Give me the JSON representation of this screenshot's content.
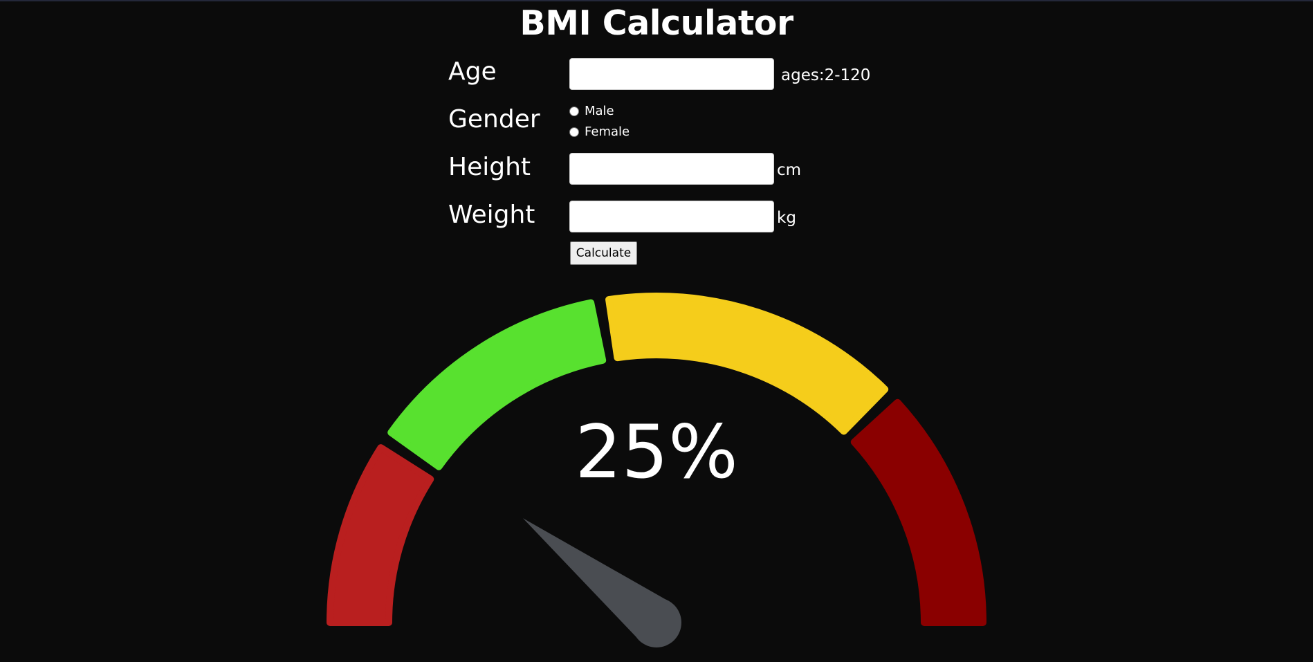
{
  "page": {
    "title": "BMI Calculator"
  },
  "form": {
    "age": {
      "label": "Age",
      "value": "",
      "hint": "ages:2-120"
    },
    "gender": {
      "label": "Gender",
      "options": [
        "Male",
        "Female"
      ],
      "selected": null
    },
    "height": {
      "label": "Height",
      "value": "",
      "unit": "cm"
    },
    "weight": {
      "label": "Weight",
      "value": "",
      "unit": "kg"
    },
    "calculate_label": "Calculate"
  },
  "gauge": {
    "display_text": "25%",
    "value_fraction": 0.25,
    "segment_colors": {
      "underweight": "#b91f1f",
      "normal": "#58e12f",
      "overweight": "#f5cd1b",
      "obese": "#8a0000"
    },
    "needle_color": "#4a4d52"
  }
}
